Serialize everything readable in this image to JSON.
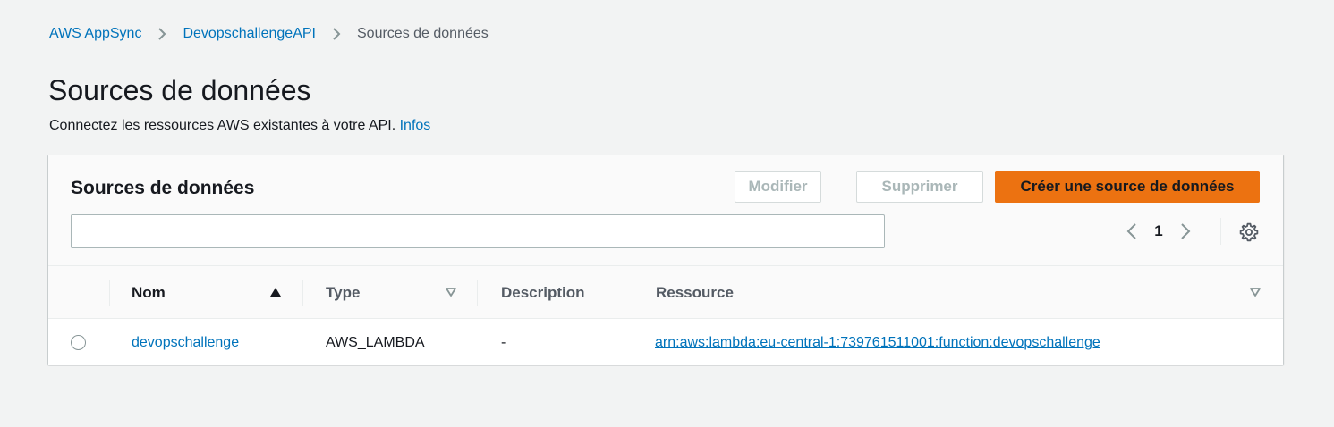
{
  "breadcrumb": {
    "items": [
      "AWS AppSync",
      "DevopschallengeAPI",
      "Sources de données"
    ]
  },
  "page": {
    "title": "Sources de données",
    "description": "Connectez les ressources AWS existantes à votre API.",
    "info_link": "Infos"
  },
  "panel": {
    "title": "Sources de données",
    "buttons": {
      "edit": "Modifier",
      "delete": "Supprimer",
      "create": "Créer une source de données"
    },
    "search": {
      "value": "",
      "placeholder": ""
    },
    "pagination": {
      "current_page": "1"
    }
  },
  "table": {
    "columns": [
      "Nom",
      "Type",
      "Description",
      "Ressource"
    ],
    "sort": {
      "column": "Nom",
      "direction": "ascending"
    },
    "rows": [
      {
        "name": "devopschallenge",
        "type": "AWS_LAMBDA",
        "description": "-",
        "resource": "arn:aws:lambda:eu-central-1:739761511001:function:devopschallenge"
      }
    ]
  },
  "colors": {
    "link": "#0073bb",
    "primary_button": "#ec7211",
    "background": "#f2f3f3",
    "disabled_text": "#aab7b8"
  },
  "icons": [
    "chevron-right-icon",
    "chevron-left-icon",
    "gear-icon",
    "sort-ascending-icon",
    "sort-descending-icon",
    "radio-icon"
  ]
}
